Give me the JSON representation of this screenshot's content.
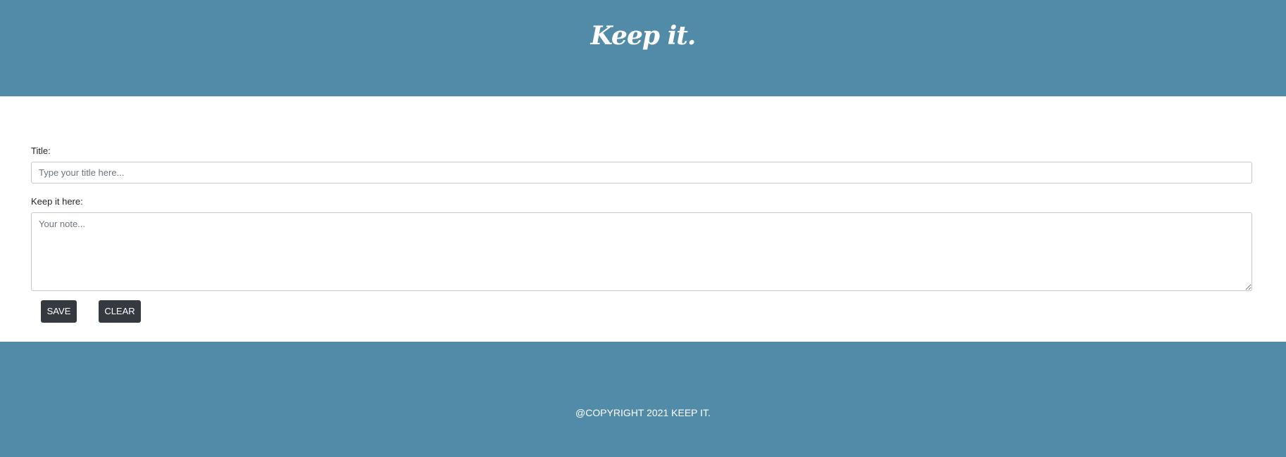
{
  "header": {
    "brand": "Keep it."
  },
  "form": {
    "title_label": "Title:",
    "title_placeholder": "Type your title here...",
    "title_value": "",
    "note_label": "Keep it here:",
    "note_placeholder": "Your note...",
    "note_value": "",
    "save_label": "SAVE",
    "clear_label": "CLEAR"
  },
  "footer": {
    "copyright": "@COPYRIGHT 2021 KEEP IT."
  },
  "colors": {
    "brand_blue": "#528ba8",
    "button_dark": "#343a40",
    "text": "#212529"
  }
}
